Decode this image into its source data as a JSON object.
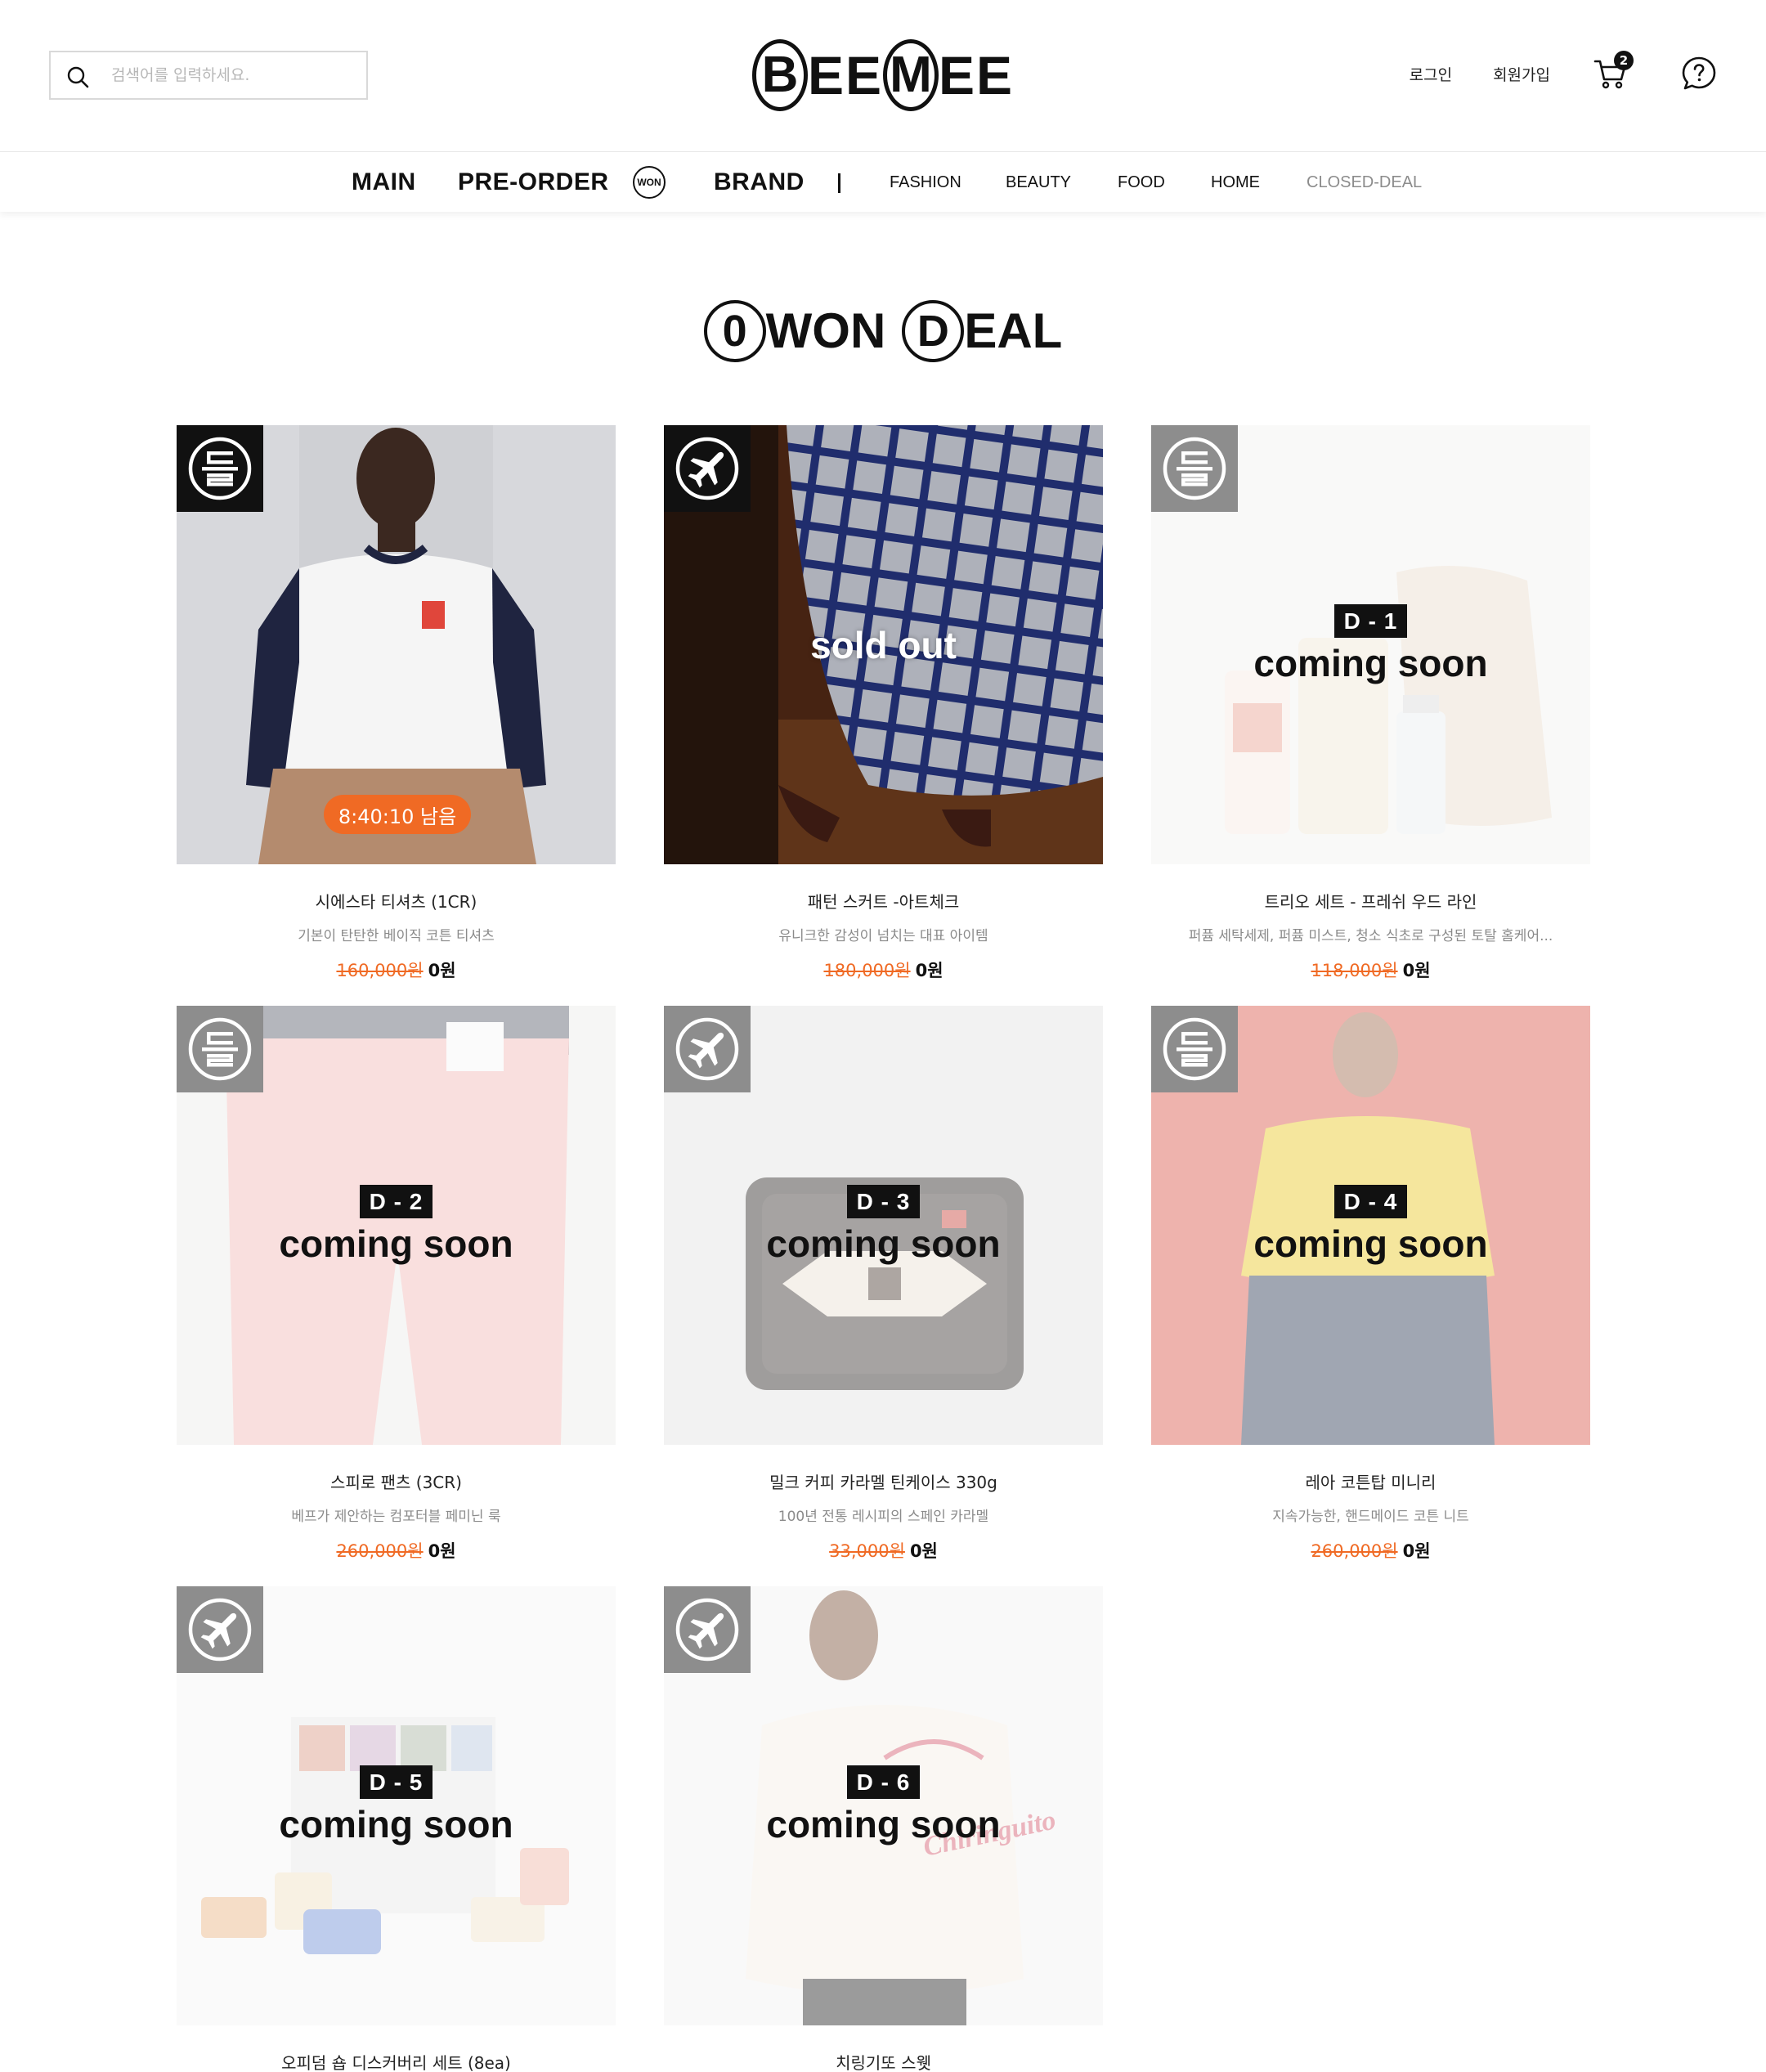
{
  "search": {
    "placeholder": "검색어를 입력하세요."
  },
  "logo": {
    "c1": "B",
    "t1": "EE",
    "c2": "M",
    "t2": "EE"
  },
  "header": {
    "login": "로그인",
    "signup": "회원가입",
    "cart_count": "2"
  },
  "nav": {
    "main": "MAIN",
    "preorder": "PRE-ORDER",
    "won": "WON",
    "brand": "BRAND",
    "fashion": "FASHION",
    "beauty": "BEAUTY",
    "food": "FOOD",
    "home": "HOME",
    "closed": "CLOSED-DEAL"
  },
  "section_title": {
    "c1": "0",
    "t1": "WON",
    "c2": "D",
    "t2": "EAL"
  },
  "colors": {
    "accent": "#f06a24",
    "badge_dark": "#111111",
    "badge_grey": "#8d8d8d"
  },
  "products": [
    {
      "name": "시에스타 티셔츠 (1CR)",
      "desc": "기본이 탄탄한 베이직 코튼 티셔츠",
      "orig": "160,000원",
      "sale": "0원",
      "status": "active",
      "timer": "8:40:10 남음",
      "badge": "domestic-icon"
    },
    {
      "name": "패턴 스커트 -아트체크",
      "desc": "유니크한 감성이 넘치는 대표 아이템",
      "orig": "180,000원",
      "sale": "0원",
      "status": "sold out",
      "badge": "airplane-icon"
    },
    {
      "name": "트리오 세트 - 프레쉬 우드 라인",
      "desc": "퍼퓸 세탁세제, 퍼퓸 미스트, 청소 식초로 구성된 토탈 홈케어...",
      "orig": "118,000원",
      "sale": "0원",
      "status": "coming soon",
      "dday": "D - 1",
      "badge": "domestic-icon"
    },
    {
      "name": "스피로 팬츠 (3CR)",
      "desc": "베프가 제안하는 컴포터블 페미닌 룩",
      "orig": "260,000원",
      "sale": "0원",
      "status": "coming soon",
      "dday": "D - 2",
      "badge": "domestic-icon"
    },
    {
      "name": "밀크 커피 카라멜 틴케이스 330g",
      "desc": "100년 전통 레시피의 스페인 카라멜",
      "orig": "33,000원",
      "sale": "0원",
      "status": "coming soon",
      "dday": "D - 3",
      "badge": "airplane-icon"
    },
    {
      "name": "레아 코튼탑 미니리",
      "desc": "지속가능한, 핸드메이드 코튼 니트",
      "orig": "260,000원",
      "sale": "0원",
      "status": "coming soon",
      "dday": "D - 4",
      "badge": "domestic-icon"
    },
    {
      "name": "오피덤 숍 디스커버리 세트 (8ea)",
      "status": "coming soon",
      "dday": "D - 5",
      "badge": "airplane-icon"
    },
    {
      "name": "치링기또 스웻",
      "status": "coming soon",
      "dday": "D - 6",
      "badge": "airplane-icon"
    }
  ]
}
